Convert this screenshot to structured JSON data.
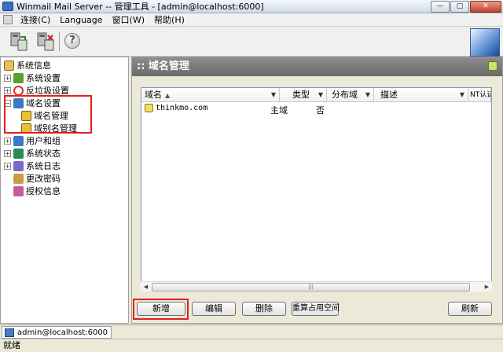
{
  "window": {
    "title": "Winmail Mail Server -- 管理工具 - [admin@localhost:6000]",
    "minimize": "—",
    "maximize": "□",
    "close": "✕"
  },
  "menu": [
    "连接(C)",
    "Language",
    "窗口(W)",
    "帮助(H)"
  ],
  "toolbar": {
    "help_label": "?"
  },
  "tree": {
    "root": "系统信息",
    "items": [
      {
        "label": "系统设置",
        "expander": "+",
        "icon_color": "#5aa02c",
        "icon": "settings-icon"
      },
      {
        "label": "反垃圾设置",
        "expander": "+",
        "icon_color": "#d83030",
        "icon": "no-spam-icon"
      },
      {
        "label": "域名设置",
        "expander": "−",
        "icon_color": "#3c78c8",
        "icon": "domain-settings-icon"
      },
      {
        "label": "域名管理",
        "expander": "",
        "icon_color": "#e8c030",
        "icon": "domain-manage-icon"
      },
      {
        "label": "域别名管理",
        "expander": "",
        "icon_color": "#e8c030",
        "icon": "domain-alias-icon"
      },
      {
        "label": "用户和组",
        "expander": "+",
        "icon_color": "#3c78c8",
        "icon": "users-icon"
      },
      {
        "label": "系统状态",
        "expander": "+",
        "icon_color": "#2a8a5a",
        "icon": "status-icon"
      },
      {
        "label": "系统日志",
        "expander": "+",
        "icon_color": "#7a6ac8",
        "icon": "log-icon"
      },
      {
        "label": "更改密码",
        "expander": "",
        "icon_color": "#c8a040",
        "icon": "password-icon"
      },
      {
        "label": "授权信息",
        "expander": "",
        "icon_color": "#c85a9a",
        "icon": "license-icon"
      }
    ]
  },
  "panel": {
    "title": ":: 域名管理",
    "columns": [
      "域名",
      "类型",
      "分布域",
      "描述",
      "NT认证"
    ],
    "sort_indicator": "▲",
    "dropdown_indicator": "▼",
    "rows": [
      {
        "domain": "thinkmo.com",
        "type": "主域",
        "distributed": "否",
        "desc": "",
        "nt": ""
      }
    ],
    "scroll_left": "◀",
    "scroll_right": "▶",
    "scroll_grip": "|||"
  },
  "buttons": {
    "add": "新增",
    "edit": "编辑",
    "delete": "删除",
    "recalc": "重算占用空间",
    "refresh": "刷新"
  },
  "status": {
    "tab": "admin@localhost:6000",
    "text": "就绪"
  },
  "colors": {
    "highlight": "#e02020",
    "header_bg": "#7a7a7a"
  }
}
